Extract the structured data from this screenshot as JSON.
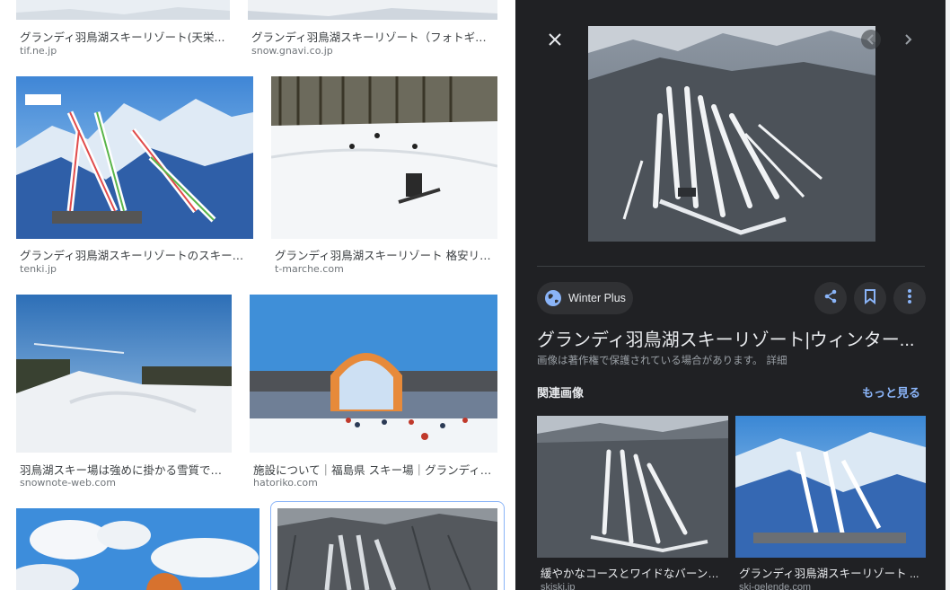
{
  "results": {
    "row0": [
      {
        "title": "グランディ羽鳥湖スキーリゾート(天栄...",
        "source": "tif.ne.jp"
      },
      {
        "title": "グランディ羽鳥湖スキーリゾート（フォトギャ...",
        "source": "snow.gnavi.co.jp"
      }
    ],
    "row1": [
      {
        "title": "グランディ羽鳥湖スキーリゾートのスキー場...",
        "source": "tenki.jp"
      },
      {
        "title": "グランディ羽鳥湖スキーリゾート 格安リフ...",
        "source": "t-marche.com"
      }
    ],
    "row2": [
      {
        "title": "羽鳥湖スキー場は強めに掛かる雪質でパ...",
        "source": "snownote-web.com"
      },
      {
        "title": "施設について｜福島県 スキー場｜グランディ羽...",
        "source": "hatoriko.com"
      }
    ]
  },
  "preview": {
    "close_icon": "close-icon",
    "source_name": "Winter Plus",
    "title": "グランディ羽鳥湖スキーリゾート|ウィンター...",
    "copyright": "画像は著作権で保護されている場合があります。",
    "detail_link": "詳細",
    "related_heading": "関連画像",
    "more_link": "もっと見る",
    "related": [
      {
        "title": "緩やかなコースとワイドなバーンで...",
        "source": "skiski.jp"
      },
      {
        "title": "グランディ羽鳥湖スキーリゾート ...",
        "source": "ski-gelende.com"
      }
    ]
  },
  "colors": {
    "panel_bg": "#202124",
    "accent": "#8ab4f8",
    "chip_bg": "#303134"
  }
}
